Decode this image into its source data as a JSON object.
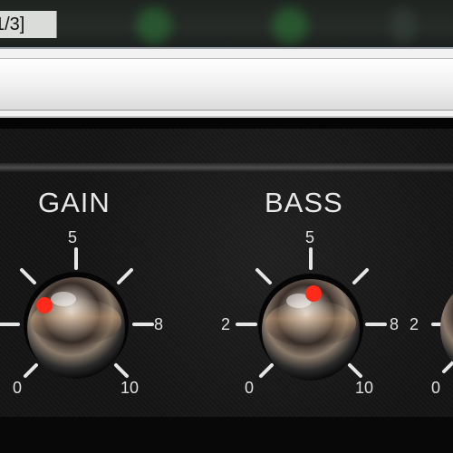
{
  "window": {
    "title_fragment": "1/3]"
  },
  "panel": {
    "knobs": [
      {
        "label": "GAIN",
        "scale": {
          "min": "0",
          "mid": "5",
          "left": "",
          "right": "8",
          "max": "10"
        },
        "indicator_color": "#ff2a1a"
      },
      {
        "label": "BASS",
        "scale": {
          "min": "0",
          "mid": "5",
          "left": "2",
          "right": "8",
          "max": "10"
        },
        "indicator_color": "#ff2a1a"
      },
      {
        "label": "",
        "scale": {
          "min": "0",
          "mid": "",
          "left": "2",
          "right": "",
          "max": ""
        },
        "indicator_color": "#ff2a1a"
      }
    ]
  },
  "colors": {
    "panel": "#141414",
    "label_text": "#e8e8e8",
    "toolbar": "#f2f2f2"
  },
  "icons": {
    "knob": "chrome-knob-icon"
  }
}
